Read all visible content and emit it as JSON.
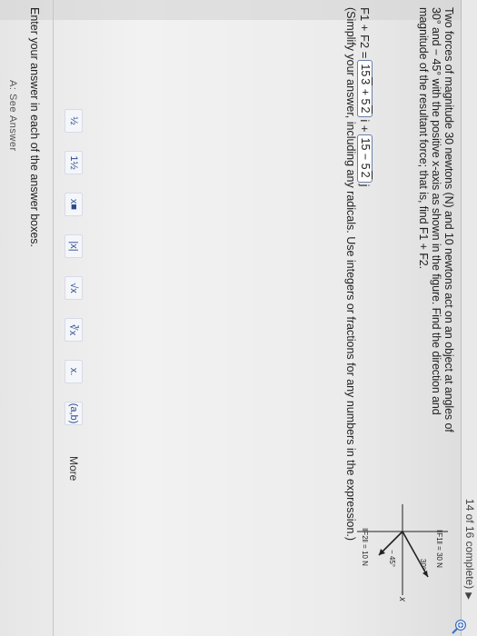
{
  "header": {
    "progress": "14 of 16 complete)"
  },
  "question": {
    "text": "Two forces of magnitude 30 newtons (N) and 10 newtons act on an object at angles of 30° and − 45° with the positive x-axis as shown in the figure. Find the direction and magnitude of the resultant force; that is, find F1 + F2."
  },
  "figure": {
    "f1_label": "‖F1‖ = 30 N",
    "f2_label": "‖F2‖ = 10 N",
    "angle1": "30°",
    "angle2": "− 45°",
    "x_label": "x"
  },
  "answer": {
    "lhs": "F1 + F2 =",
    "box1_prefix": "15",
    "box1_rad1": "3",
    "box1_mid": "+ 5",
    "box1_rad2": "2",
    "i_unit": "i +",
    "box2_prefix": "15 − 5",
    "box2_rad": "2",
    "j_unit": "j"
  },
  "hint": "(Simplify your answer, including any radicals. Use integers or fractions for any numbers in the expression.)",
  "toolbar": {
    "tools": [
      "½",
      "1½",
      "x■",
      "|x|",
      "√x",
      "∛x",
      "x.",
      "(a,b)"
    ],
    "more_label": "More"
  },
  "instruction": "Enter your answer in each of the answer boxes.",
  "see_answer": "A: See Answer"
}
